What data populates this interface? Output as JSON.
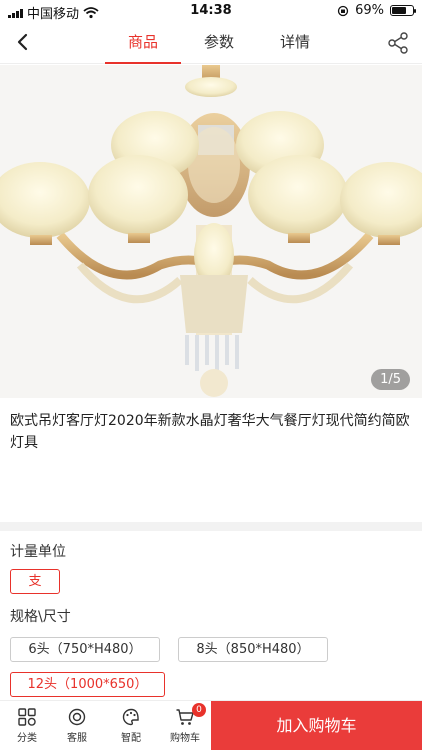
{
  "status_bar": {
    "carrier": "中国移动",
    "time": "14:38",
    "battery": "69%",
    "battery_level": 0.69
  },
  "nav": {
    "tabs": [
      {
        "label": "商品"
      },
      {
        "label": "参数"
      },
      {
        "label": "详情"
      }
    ]
  },
  "gallery": {
    "counter": "1/5"
  },
  "product": {
    "title": "欧式吊灯客厅灯2020年新款水晶灯奢华大气餐厅灯现代简约简欧灯具"
  },
  "specs": {
    "unit_label": "计量单位",
    "unit_options": [
      {
        "label": "支"
      }
    ],
    "size_label": "规格\\尺寸",
    "size_options": [
      {
        "label": "6头（750*H480）"
      },
      {
        "label": "8头（850*H480）"
      },
      {
        "label": "12头（1000*650）"
      }
    ]
  },
  "bottom_bar": {
    "category": "分类",
    "service": "客服",
    "smart_match": "智配",
    "cart": "购物车",
    "cart_count": "0",
    "add_to_cart": "加入购物车"
  },
  "colors": {
    "accent": "#e8322b"
  }
}
